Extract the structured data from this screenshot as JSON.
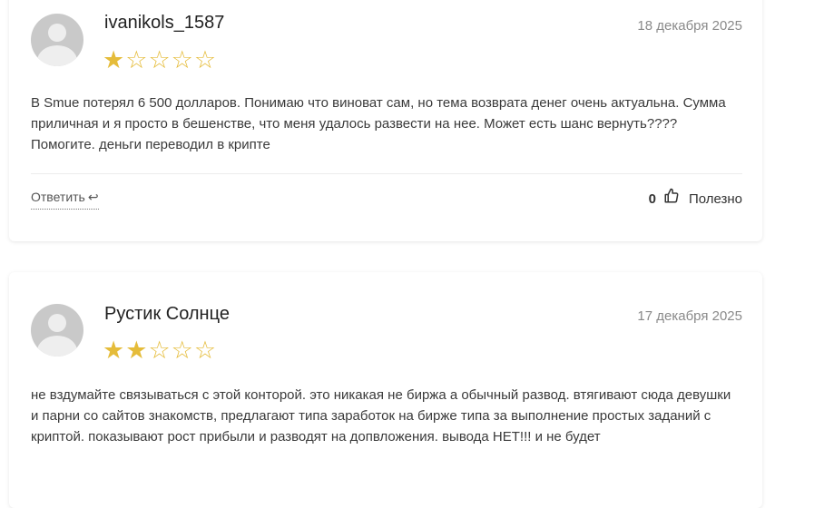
{
  "reviews": [
    {
      "author": "ivanikols_1587",
      "date": "18 декабря 2025",
      "rating": 1,
      "max_rating": 5,
      "text": "В Smue потерял 6 500 долларов. Понимаю что виноват сам, но тема возврата денег очень актуальна. Сумма приличная и я просто в бешенстве, что меня удалось развести на нее. Может есть шанс вернуть???? Помогите. деньги переводил в крипте",
      "reply_label": "Ответить",
      "reply_icon": "↩",
      "helpful_count": "0",
      "helpful_label": "Полезно",
      "like_icon": "👍"
    },
    {
      "author": "Рустик Солнце",
      "date": "17 декабря 2025",
      "rating": 2,
      "max_rating": 5,
      "text": "не вздумайте связываться с этой конторой. это никакая не биржа а обычный развод. втягивают сюда девушки и парни со сайтов знакомств, предлагают типа заработок на бирже типа за выполнение простых заданий с криптой. показывают рост прибыли и разводят на допвложения. вывода НЕТ!!! и не будет"
    }
  ],
  "colors": {
    "star": "#e5bc3a",
    "avatar_bg": "#c9c9c9",
    "date": "#8a8a8a"
  }
}
